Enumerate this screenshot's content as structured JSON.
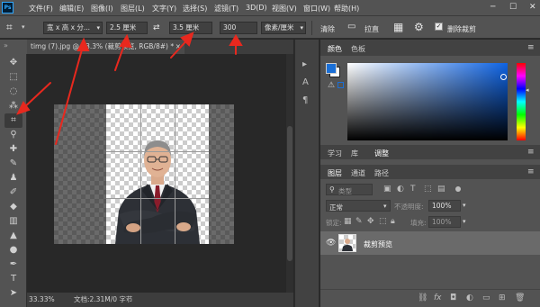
{
  "app": {
    "logo": "Ps",
    "brand_color": "#31a8ff"
  },
  "menu": [
    "文件(F)",
    "编辑(E)",
    "图像(I)",
    "图层(L)",
    "文字(Y)",
    "选择(S)",
    "滤镜(T)",
    "3D(D)",
    "视图(V)",
    "窗口(W)",
    "帮助(H)"
  ],
  "window_controls": [
    "minimize",
    "maximize",
    "close"
  ],
  "options": {
    "ratio": "宽 x 高 x 分...",
    "width": "2.5 厘米",
    "height": "3.5 厘米",
    "resolution": "300",
    "unit": "像素/厘米",
    "clear": "清除",
    "straighten": "拉直",
    "delete_cropped": "删除裁剪"
  },
  "document": {
    "tab_title": "timg (7).jpg @ 33.3% (裁剪预览, RGB/8#) *",
    "zoom": "33.33%",
    "doc_info": "文档:2.31M/0 字节"
  },
  "color_panel": {
    "tabs": [
      "颜色",
      "色板"
    ],
    "active_tab": "颜色",
    "foreground": "#1a6fd6",
    "background": "#ffffff"
  },
  "learn_tabs": [
    "学习",
    "库",
    "调整"
  ],
  "layers_panel": {
    "tabs": [
      "图层",
      "通道",
      "路径"
    ],
    "filter": "类型",
    "blend_mode": "正常",
    "opacity_label": "不透明度:",
    "opacity": "100%",
    "lock_label": "锁定:",
    "fill_label": "填充:",
    "fill": "100%",
    "layers": [
      {
        "name": "裁剪预览",
        "visible": true
      }
    ]
  },
  "tools": [
    "move-tool",
    "marquee-tool",
    "lasso-tool",
    "magic-wand-tool",
    "crop-tool",
    "eyedropper-tool",
    "healing-tool",
    "brush-tool",
    "stamp-tool",
    "history-brush-tool",
    "eraser-tool",
    "gradient-tool",
    "blur-tool",
    "dodge-tool",
    "pen-tool",
    "type-tool",
    "path-select-tool"
  ],
  "annotation_color": "#e8281e"
}
